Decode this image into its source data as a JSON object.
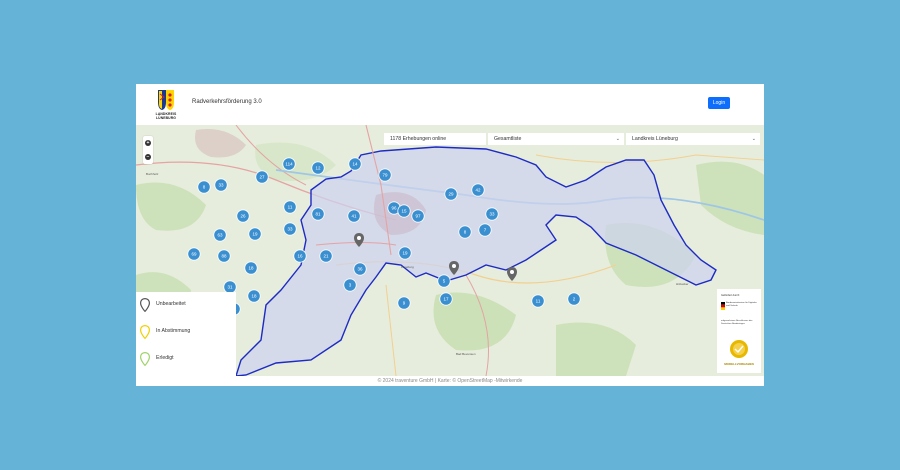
{
  "header": {
    "logo_text": "LANDKREIS LÜNEBURG",
    "title": "Radverkehrsförderung 3.0",
    "login_label": "Login"
  },
  "map": {
    "zoom_in_label": "+",
    "zoom_out_label": "−",
    "count_text": "1178 Erhebungen online",
    "list_select": "Gesamtliste",
    "region_select": "Landkreis Lüneburg",
    "clusters": [
      "114",
      "12",
      "14",
      "79",
      "27",
      "8",
      "33",
      "11",
      "96",
      "26",
      "33",
      "41",
      "81",
      "63",
      "19",
      "29",
      "42",
      "33",
      "8",
      "97",
      "15",
      "88",
      "18",
      "16",
      "21",
      "19",
      "36",
      "69",
      "31",
      "18",
      "11",
      "9",
      "17",
      "7",
      "5",
      "3",
      "11",
      "2"
    ]
  },
  "legend": {
    "items": [
      {
        "label": "Unbearbeitet",
        "color": "#555555"
      },
      {
        "label": "In Abstimmung",
        "color": "#f0d000"
      },
      {
        "label": "Erledigt",
        "color": "#9ed36a"
      }
    ]
  },
  "sponsor": {
    "gefoerdert": "Gefördert durch:",
    "ministry": "Bundesministerium für Digitales und Verkehr",
    "beschluss": "aufgrund eines Beschlusses des Deutschen Bundestages",
    "modell": "MODELLVORHABEN"
  },
  "footer": {
    "text": "© 2024 traventure GmbH | Karte: © OpenStreetMap -Mitwirkende"
  },
  "colors": {
    "background": "#66b3d8",
    "accent": "#0d6efd",
    "cluster": "#3a8fd0",
    "boundary": "#1d2bc4"
  }
}
